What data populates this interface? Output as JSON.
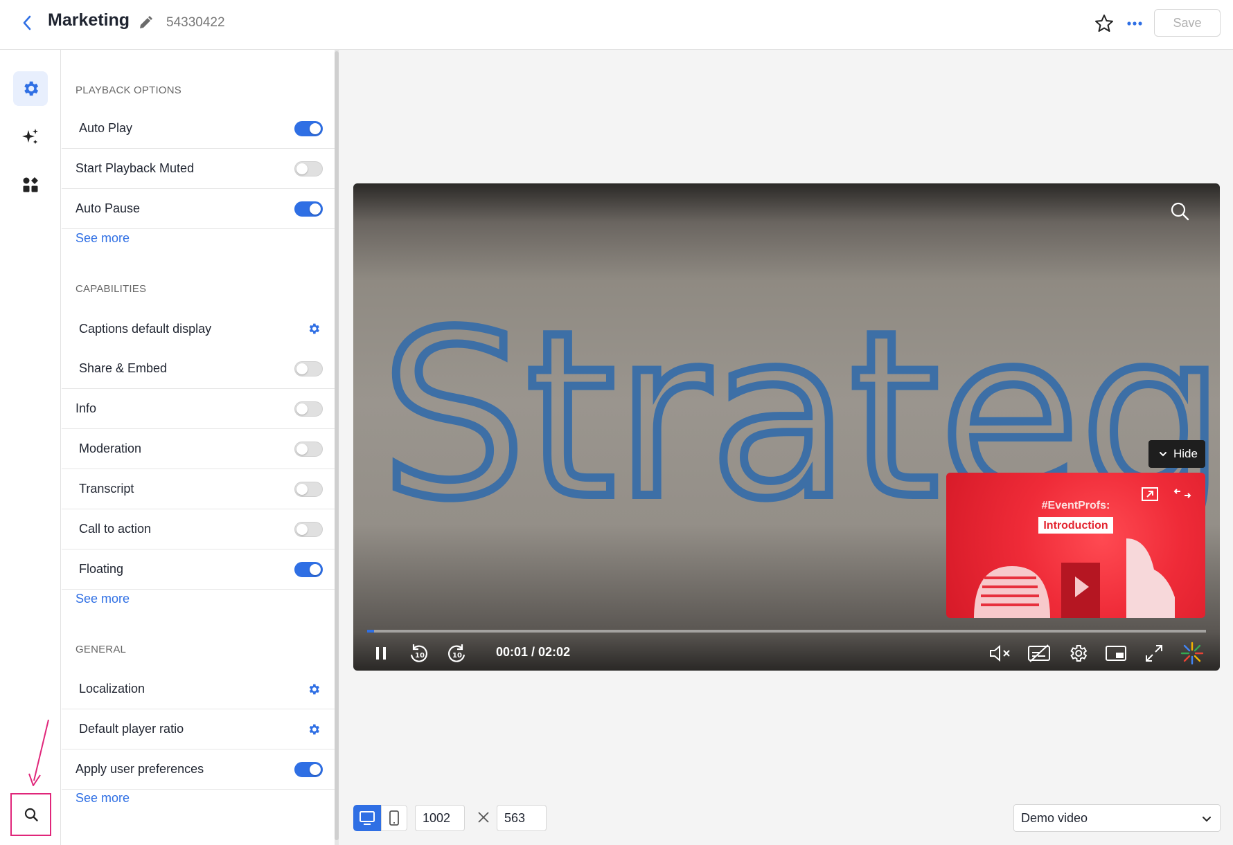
{
  "header": {
    "title": "Marketing",
    "video_id": "54330422",
    "save_label": "Save"
  },
  "sections": {
    "playback_title": "PLAYBACK OPTIONS",
    "capabilities_title": "CAPABILITIES",
    "general_title": "GENERAL",
    "see_more": "See more"
  },
  "playback_rows": [
    {
      "label": "Auto Play",
      "control": "toggle",
      "on": true
    },
    {
      "label": "Start Playback Muted",
      "control": "toggle",
      "on": false
    },
    {
      "label": "Auto Pause",
      "control": "toggle",
      "on": true
    }
  ],
  "capability_rows": [
    {
      "label": "Captions default display",
      "control": "gear"
    },
    {
      "label": "Share & Embed",
      "control": "toggle",
      "on": false
    },
    {
      "label": "Info",
      "control": "toggle",
      "on": false
    },
    {
      "label": "Moderation",
      "control": "toggle",
      "on": false
    },
    {
      "label": "Transcript",
      "control": "toggle",
      "on": false
    },
    {
      "label": "Call to action",
      "control": "toggle",
      "on": false
    },
    {
      "label": "Floating",
      "control": "toggle",
      "on": true
    }
  ],
  "general_rows": [
    {
      "label": "Localization",
      "control": "gear"
    },
    {
      "label": "Default player ratio",
      "control": "gear"
    },
    {
      "label": "Apply user preferences",
      "control": "toggle",
      "on": true
    }
  ],
  "player": {
    "time": "00:01 / 02:02",
    "progress": 0.008,
    "hide_label": "Hide",
    "floating_title": "#EventProfs:",
    "floating_subtitle": "Introduction",
    "video_text": "Strategy"
  },
  "toolbar": {
    "width_value": "1002",
    "height_value": "563",
    "video_select": "Demo video"
  },
  "colors": {
    "accent": "#2f6fe4",
    "annotation": "#e0267a"
  }
}
